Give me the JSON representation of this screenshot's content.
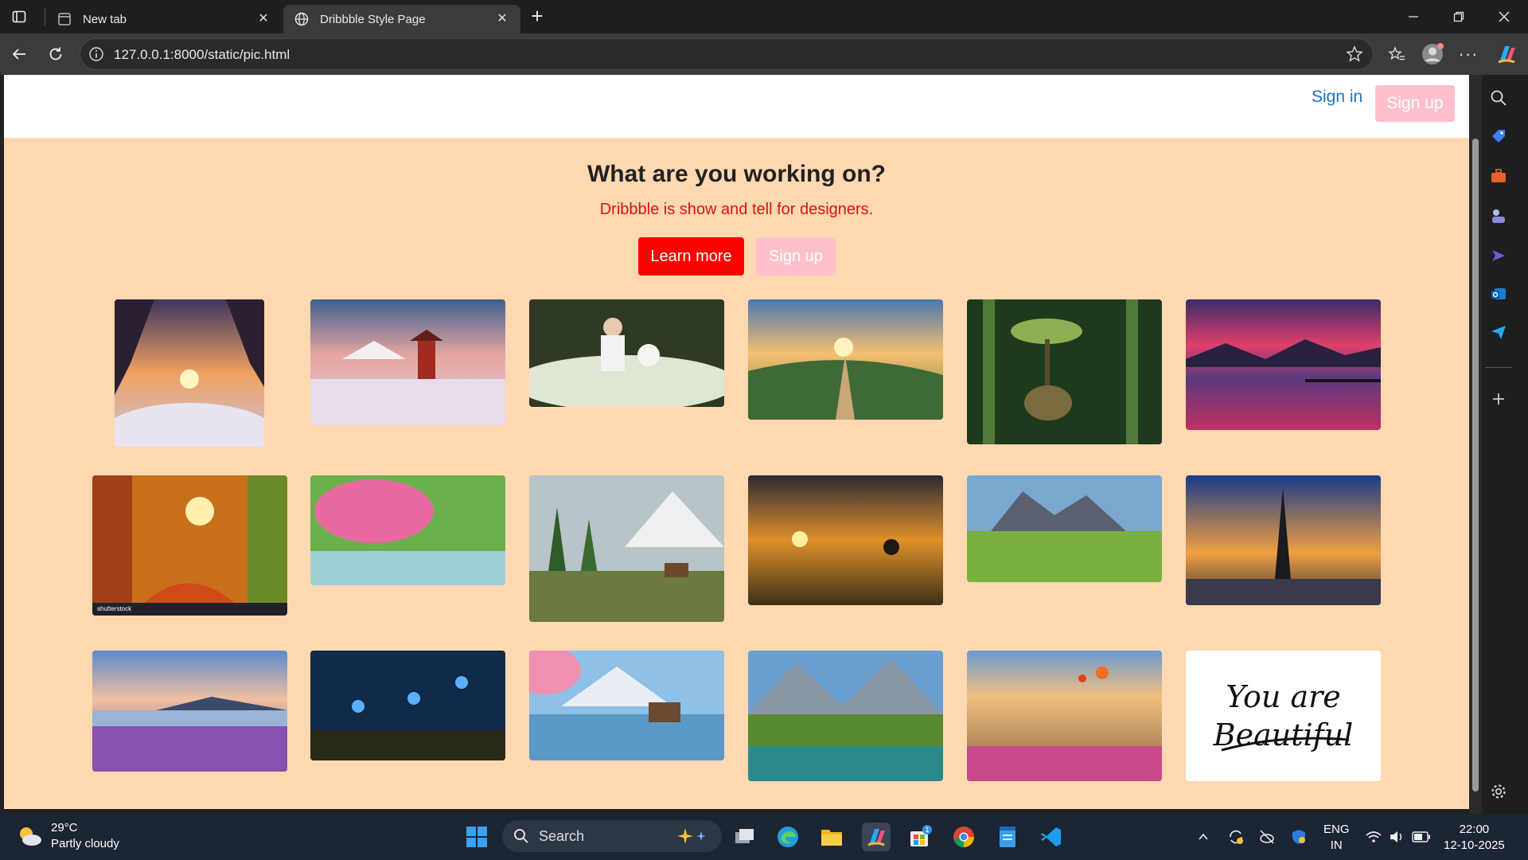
{
  "browser": {
    "tabs": [
      {
        "title": "New tab"
      },
      {
        "title": "Dribbble Style Page"
      }
    ],
    "url": "127.0.0.1:8000/static/pic.html"
  },
  "page": {
    "header": {
      "signin": "Sign in",
      "signup": "Sign up"
    },
    "hero": {
      "title": "What are you working on?",
      "subtitle": "Dribbble is show and tell for designers.",
      "learn_more": "Learn more",
      "signup": "Sign up"
    },
    "gallery": {
      "watermark": "shutterstock",
      "last_card_text": [
        "You are",
        "Beautiful"
      ]
    },
    "colors": {
      "page_bg": "#fed8b1",
      "accent": "#ff0000",
      "pink": "#ffc0cb",
      "link": "#1a73c8"
    }
  },
  "taskbar": {
    "weather": {
      "temp": "29°C",
      "desc": "Partly cloudy"
    },
    "search_label": "Search",
    "language": [
      "ENG",
      "IN"
    ],
    "time": "22:00",
    "date": "12-10-2025",
    "store_badge": "1"
  }
}
